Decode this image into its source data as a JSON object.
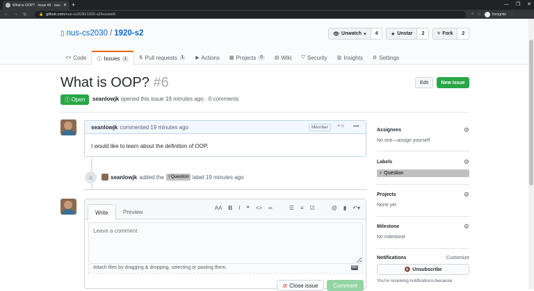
{
  "browser": {
    "tab_title": "What is OOP? · Issue #6 · nus-cs...",
    "url_domain": "github.com",
    "url_path": "/nus-cs2030/1920-s2/issues/6",
    "profile_label": "Incognito"
  },
  "repo": {
    "owner": "nus-cs2030",
    "separator": "/",
    "name": "1920-s2",
    "watch": {
      "label": "Unwatch",
      "count": "4"
    },
    "star": {
      "label": "Unstar",
      "count": "2"
    },
    "fork": {
      "label": "Fork",
      "count": "2"
    }
  },
  "tabs": [
    {
      "label": "Code",
      "count": ""
    },
    {
      "label": "Issues",
      "count": "1"
    },
    {
      "label": "Pull requests",
      "count": "1"
    },
    {
      "label": "Actions",
      "count": ""
    },
    {
      "label": "Projects",
      "count": "0"
    },
    {
      "label": "Wiki",
      "count": ""
    },
    {
      "label": "Security",
      "count": ""
    },
    {
      "label": "Insights",
      "count": ""
    },
    {
      "label": "Settings",
      "count": ""
    }
  ],
  "issue": {
    "title": "What is OOP?",
    "number": "#6",
    "edit_label": "Edit",
    "new_issue_label": "New issue",
    "state": "Open",
    "author": "seanlowjk",
    "meta_text": "opened this issue 19 minutes ago · 0 comments"
  },
  "comment": {
    "author": "seanlowjk",
    "action": "commented 19 minutes ago",
    "role": "Member",
    "body": "I would like to learn about the definition of OOP."
  },
  "event": {
    "actor": "seanlowjk",
    "prefix": "added the",
    "label": "Question",
    "suffix": "label 19 minutes ago"
  },
  "editor": {
    "write_tab": "Write",
    "preview_tab": "Preview",
    "placeholder": "Leave a comment",
    "attach_text": "Attach files by dragging & dropping, selecting or pasting them.",
    "md_badge": "MD",
    "close_label": "Close issue",
    "comment_label": "Comment"
  },
  "sidebar": {
    "assignees": {
      "title": "Assignees",
      "value": "No one—assign yourself"
    },
    "labels": {
      "title": "Labels",
      "value": "Question"
    },
    "projects": {
      "title": "Projects",
      "value": "None yet"
    },
    "milestone": {
      "title": "Milestone",
      "value": "No milestone"
    },
    "notifications": {
      "title": "Notifications",
      "customize": "Customize",
      "button": "Unsubscribe",
      "note": "You're receiving notifications because"
    }
  },
  "colors": {
    "open_green": "#28a745",
    "link_blue": "#0366d6",
    "tab_accent": "#e36209",
    "label_gray": "#c0c0c0"
  }
}
